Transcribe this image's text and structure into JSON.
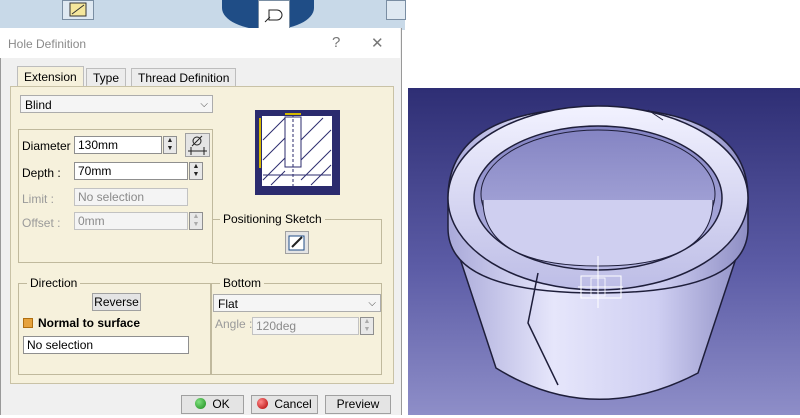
{
  "dialog": {
    "title": "Hole Definition",
    "help_glyph": "?",
    "close_glyph": "✕",
    "tabs": [
      "Extension",
      "Type",
      "Thread Definition"
    ],
    "extension_type": "Blind",
    "diameter": {
      "label": "Diameter :",
      "value": "130mm"
    },
    "depth": {
      "label": "Depth :",
      "value": "70mm"
    },
    "limit": {
      "label": "Limit :",
      "value": "No selection"
    },
    "offset": {
      "label": "Offset :",
      "value": "0mm"
    },
    "positioning_sketch": {
      "label": "Positioning Sketch"
    },
    "direction": {
      "label": "Direction",
      "reverse_label": "Reverse",
      "normal_to_surface": "Normal to surface",
      "selection": "No selection"
    },
    "bottom": {
      "label": "Bottom",
      "type": "Flat",
      "angle_label": "Angle :",
      "angle_value": "120deg"
    },
    "buttons": {
      "ok": "OK",
      "cancel": "Cancel",
      "preview": "Preview"
    }
  },
  "colors": {
    "viewport_top": "#2e2e74",
    "viewport_bottom": "#8e8ec8",
    "part": "#c9c9ef",
    "preview_navy": "#2b2b6e",
    "dialog_pane": "#f6f1dc"
  },
  "icons": [
    "diameter-icon",
    "sketch-icon",
    "hole-preview-icon",
    "ok-dot-icon",
    "cancel-dot-icon",
    "checkbox-icon"
  ]
}
